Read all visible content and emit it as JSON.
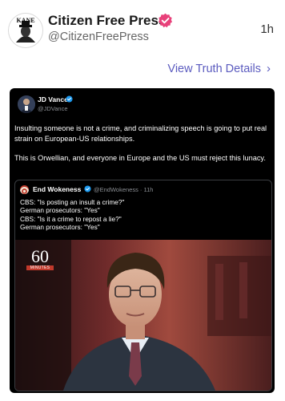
{
  "post": {
    "author_name": "Citizen Free Press",
    "author_handle": "@CitizenFreePress",
    "avatar_text": "KANE",
    "time": "1h",
    "view_link": "View Truth Details",
    "chevron_icon": "chevron-right-icon",
    "verified_color": "#e8417a",
    "link_color": "#5b5bbf"
  },
  "embed": {
    "author_name": "JD Vance",
    "author_handle": "@JDVance",
    "paragraphs": [
      "Insulting someone is not a crime, and criminalizing speech is going to put real strain on European-US relationships.",
      "This is Orwellian, and everyone in Europe and the US must reject this lunacy."
    ],
    "quote": {
      "author_name": "End Wokeness",
      "meta": "@EndWokeness · 11h",
      "lines": [
        "CBS: \"Is posting an insult a crime?\"",
        "German prosecutors: \"Yes\"",
        "CBS: \"Is it a crime to repost a lie?\"",
        "German prosecutors: \"Yes\""
      ],
      "video_logo_number": "60",
      "video_logo_text": "MINUTES"
    }
  }
}
